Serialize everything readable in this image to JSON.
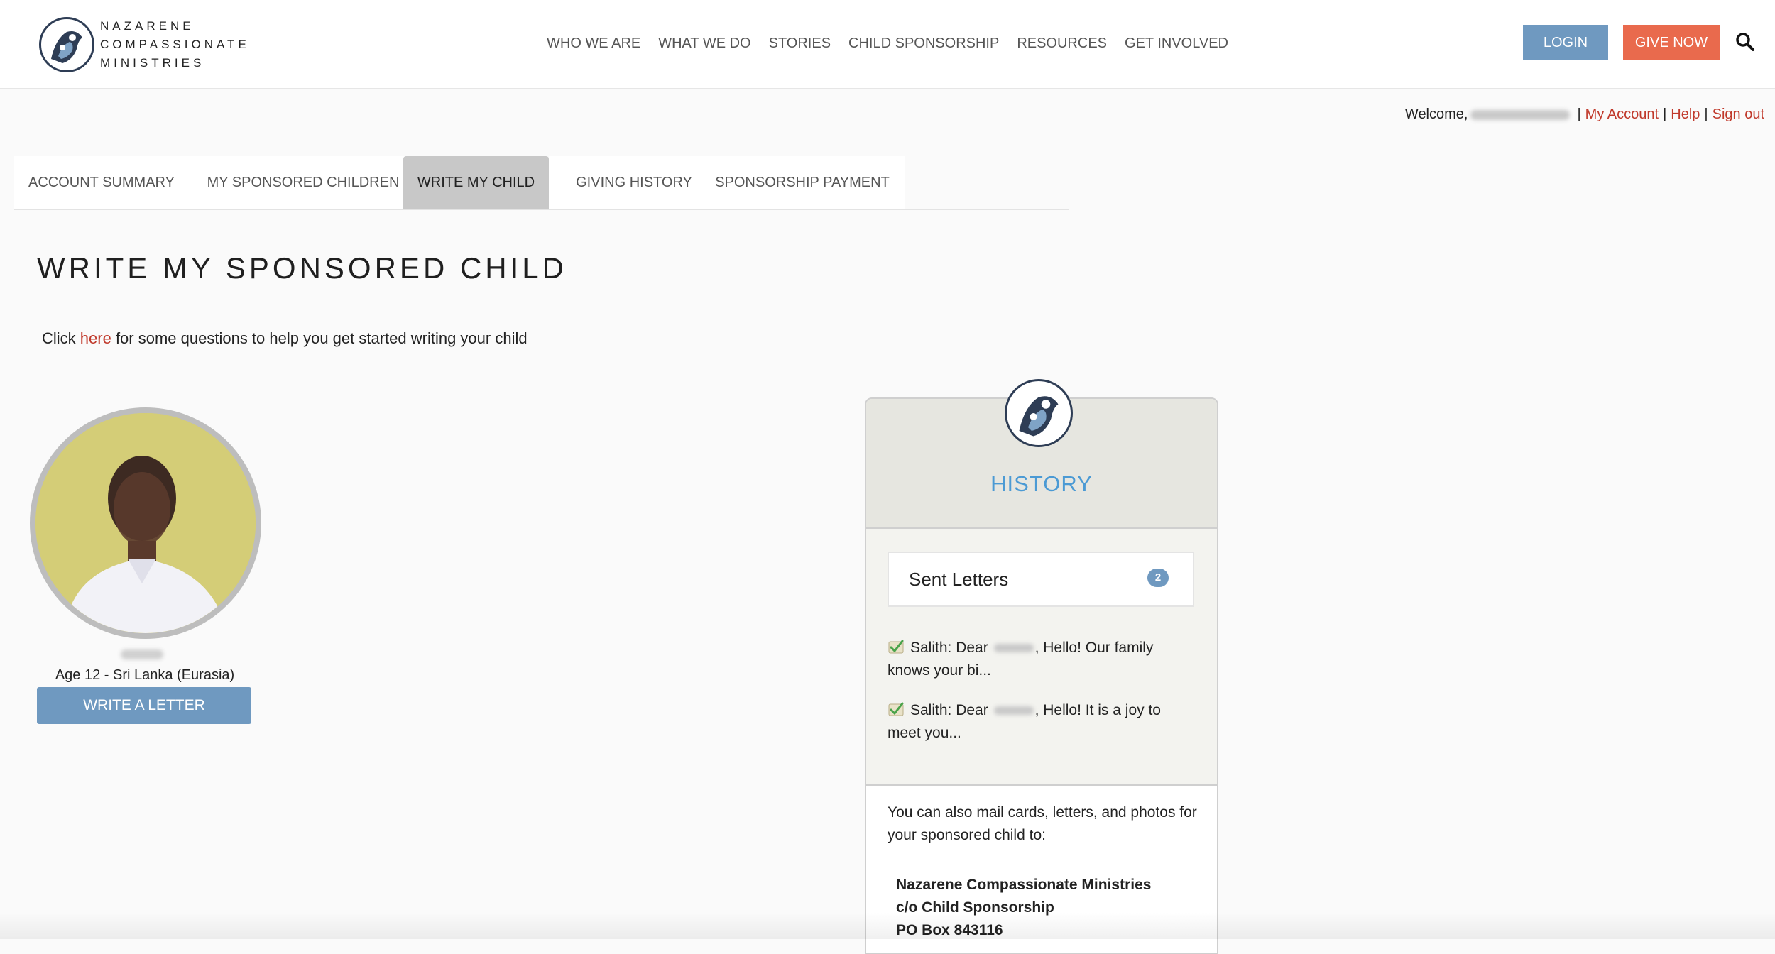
{
  "header": {
    "logo_lines": [
      "NAZARENE",
      "COMPASSIONATE",
      "MINISTRIES"
    ],
    "nav": [
      "WHO WE ARE",
      "WHAT WE DO",
      "STORIES",
      "CHILD SPONSORSHIP",
      "RESOURCES",
      "GET INVOLVED"
    ],
    "login_label": "LOGIN",
    "give_label": "GIVE NOW",
    "search_icon": "search-icon"
  },
  "account_bar": {
    "welcome_label": "Welcome,",
    "my_account_label": "My Account",
    "help_label": "Help",
    "sign_out_label": "Sign out"
  },
  "tabs": [
    {
      "label": "ACCOUNT SUMMARY",
      "active": false
    },
    {
      "label": "MY SPONSORED CHILDREN",
      "active": false
    },
    {
      "label": "WRITE MY CHILD",
      "active": true
    },
    {
      "label": "GIVING HISTORY",
      "active": false
    },
    {
      "label": "SPONSORSHIP PAYMENT",
      "active": false
    }
  ],
  "page": {
    "title": "WRITE MY SPONSORED CHILD",
    "intro_before": "Click ",
    "intro_link": "here",
    "intro_after": " for some questions to help you get started writing your child"
  },
  "child": {
    "age_location": "Age 12 - Sri Lanka (Eurasia)",
    "write_button": "WRITE A LETTER"
  },
  "history": {
    "title": "HISTORY",
    "sent_label": "Sent Letters",
    "sent_count": "2",
    "letters": [
      {
        "before": "Salith: Dear ",
        "after": ", Hello! Our family knows your bi..."
      },
      {
        "before": "Salith: Dear ",
        "after": ", Hello! It is a joy to meet you..."
      }
    ],
    "mail_text": "You can also mail cards, letters, and photos for your sponsored child to:",
    "address_lines": [
      "Nazarene Compassionate Ministries",
      "c/o Child Sponsorship",
      "PO Box 843116"
    ]
  },
  "colors": {
    "primary_blue": "#6f99c0",
    "give_orange": "#e96a4d",
    "link_red": "#c0392b",
    "history_blue": "#4b9ad4"
  }
}
